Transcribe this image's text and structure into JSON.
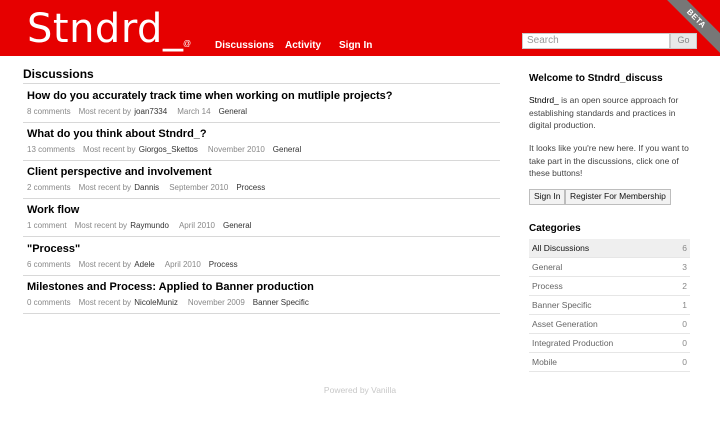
{
  "header": {
    "logo": "Stndrd_",
    "logo_sup": "@",
    "nav": [
      {
        "label": "Discussions"
      },
      {
        "label": "Activity"
      },
      {
        "label": "Sign In"
      }
    ],
    "search_placeholder": "Search",
    "go_label": "Go",
    "beta_label": "BETA"
  },
  "main": {
    "title": "Discussions",
    "discussions": [
      {
        "title": "How do you accurately track time when working on mutliple projects?",
        "comments": "8 comments",
        "recent_label": "Most recent by",
        "user": "joan7334",
        "date": "March 14",
        "category": "General"
      },
      {
        "title": "What do you think about Stndrd_?",
        "comments": "13 comments",
        "recent_label": "Most recent by",
        "user": "Giorgos_Skettos",
        "date": "November 2010",
        "category": "General"
      },
      {
        "title": "Client perspective and involvement",
        "comments": "2 comments",
        "recent_label": "Most recent by",
        "user": "Dannis",
        "date": "September 2010",
        "category": "Process"
      },
      {
        "title": "Work flow",
        "comments": "1 comment",
        "recent_label": "Most recent by",
        "user": "Raymundo",
        "date": "April 2010",
        "category": "General"
      },
      {
        "title": "\"Process\"",
        "comments": "6 comments",
        "recent_label": "Most recent by",
        "user": "Adele",
        "date": "April 2010",
        "category": "Process"
      },
      {
        "title": "Milestones and Process: Applied to Banner production",
        "comments": "0 comments",
        "recent_label": "Most recent by",
        "user": "NicoleMuniz",
        "date": "November 2009",
        "category": "Banner Specific"
      }
    ]
  },
  "sidebar": {
    "welcome_title": "Welcome to Stndrd_discuss",
    "intro_brand": "Stndrd_",
    "intro_text": " is an open source approach for establishing standards and practices in digital production.",
    "new_here": "It looks like you're new here. If you want to take part in the discussions, click one of these buttons!",
    "sign_in_label": "Sign In",
    "register_label": "Register For Membership",
    "categories_title": "Categories",
    "categories": [
      {
        "name": "All Discussions",
        "count": "6"
      },
      {
        "name": "General",
        "count": "3"
      },
      {
        "name": "Process",
        "count": "2"
      },
      {
        "name": "Banner Specific",
        "count": "1"
      },
      {
        "name": "Asset Generation",
        "count": "0"
      },
      {
        "name": "Integrated Production",
        "count": "0"
      },
      {
        "name": "Mobile",
        "count": "0"
      }
    ]
  },
  "footer": {
    "text": "Powered by Vanilla"
  },
  "colors": {
    "brand_red": "#e60000"
  }
}
